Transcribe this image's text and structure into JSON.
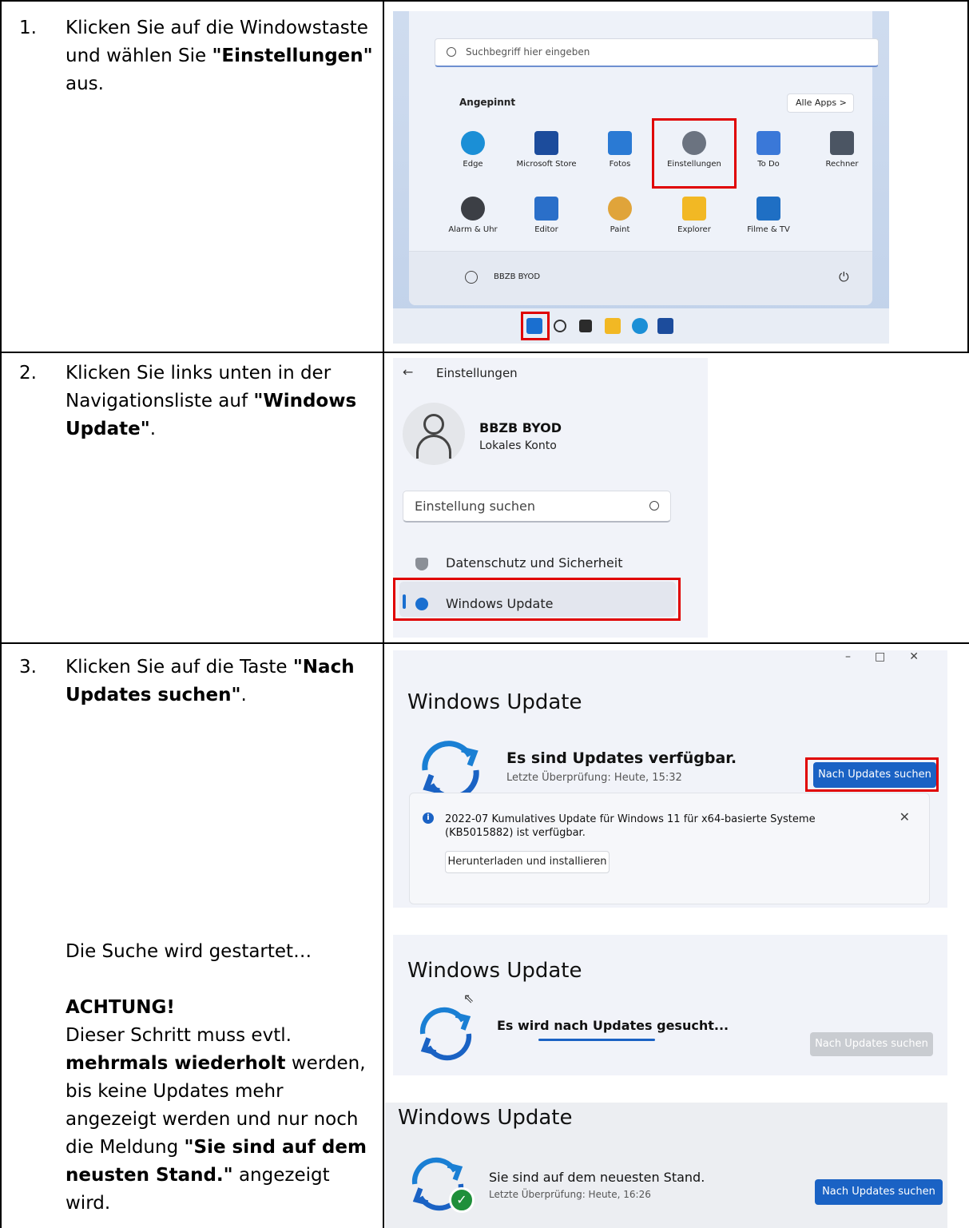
{
  "steps": [
    {
      "number": "1.",
      "text_parts": [
        "Klicken Sie auf die Windowstaste und wählen Sie ",
        "\"Einstellungen\"",
        " aus."
      ]
    },
    {
      "number": "2.",
      "text_parts": [
        "Klicken Sie links unten in der Navigationsliste auf ",
        "\"Windows Update\"",
        "."
      ]
    },
    {
      "number": "3.",
      "text_parts": [
        "Klicken Sie auf die Taste ",
        "\"Nach Updates suchen\"",
        "."
      ]
    }
  ],
  "step3_note": {
    "started": "Die Suche wird gestartet…",
    "warning_title": "ACHTUNG!",
    "parts": [
      "Dieser Schritt muss evtl. ",
      "mehrmals wiederholt",
      " werden, bis keine Updates mehr angezeigt werden und nur noch die Meldung ",
      "\"Sie sind auf dem neusten Stand.\"",
      " angezeigt wird."
    ]
  },
  "start_menu": {
    "search_placeholder": "Suchbegriff hier eingeben",
    "pinned_label": "Angepinnt",
    "all_apps": "Alle Apps  >",
    "apps": [
      {
        "label": "Edge",
        "color": "#1b8fd6"
      },
      {
        "label": "Microsoft Store",
        "color": "#1c4c9c"
      },
      {
        "label": "Fotos",
        "color": "#2a7ad4"
      },
      {
        "label": "Einstellungen",
        "color": "#6b7380"
      },
      {
        "label": "To Do",
        "color": "#3a78d8"
      },
      {
        "label": "Rechner",
        "color": "#4b5563"
      },
      {
        "label": "Alarm & Uhr",
        "color": "#3c3f45"
      },
      {
        "label": "Editor",
        "color": "#2a6fc9"
      },
      {
        "label": "Paint",
        "color": "#e0a43a"
      },
      {
        "label": "Explorer",
        "color": "#f2b824"
      },
      {
        "label": "Filme & TV",
        "color": "#1f6fc4"
      }
    ],
    "user": "BBZB BYOD",
    "power_glyph": "⏻"
  },
  "settings": {
    "back_glyph": "←",
    "title": "Einstellungen",
    "user_name": "BBZB BYOD",
    "account_type": "Lokales Konto",
    "search_placeholder": "Einstellung suchen",
    "item_privacy": "Datenschutz und Sicherheit",
    "item_update": "Windows Update"
  },
  "update_available": {
    "window_controls": "–□✕",
    "title": "Windows Update",
    "status": "Es sind Updates verfügbar.",
    "last_check": "Letzte Überprüfung: Heute, 15:32",
    "button": "Nach Updates suchen",
    "notice_text": "2022-07 Kumulatives Update für Windows 11 für x64-basierte Systeme (KB5015882) ist verfügbar.",
    "notice_close": "✕",
    "notice_button": "Herunterladen und installieren"
  },
  "update_searching": {
    "title": "Windows Update",
    "status": "Es wird nach Updates gesucht...",
    "button": "Nach Updates suchen"
  },
  "update_current": {
    "title": "Windows Update",
    "status": "Sie sind auf dem neuesten Stand.",
    "last_check": "Letzte Überprüfung: Heute, 16:26",
    "button": "Nach Updates suchen"
  },
  "colors": {
    "highlight_red": "#e00000",
    "accent_blue": "#1a62c4"
  }
}
